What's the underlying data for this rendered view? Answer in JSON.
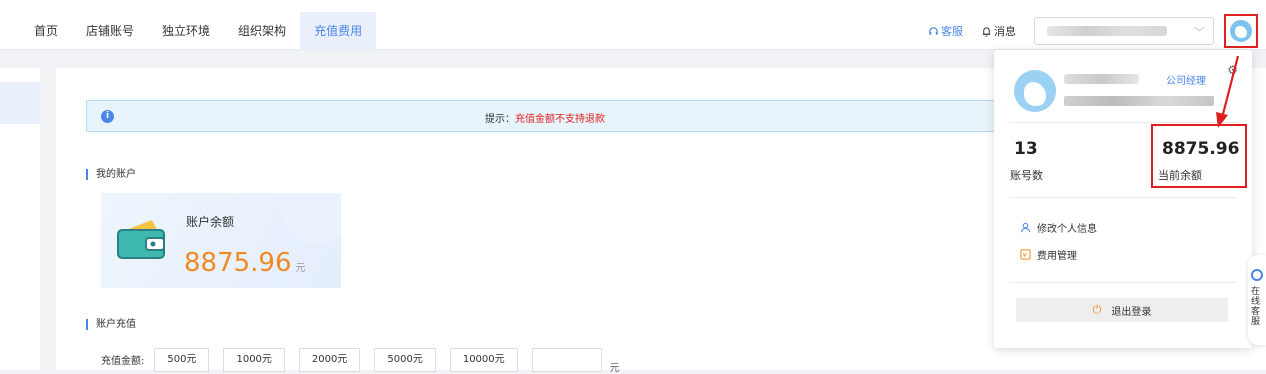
{
  "nav": {
    "items": [
      {
        "label": "首页",
        "active": false
      },
      {
        "label": "店铺账号",
        "active": false
      },
      {
        "label": "独立环境",
        "active": false
      },
      {
        "label": "组织架构",
        "active": false
      },
      {
        "label": "充值费用",
        "active": true
      }
    ]
  },
  "header": {
    "kefu_label": "客服",
    "message_label": "消息"
  },
  "alert": {
    "prefix": "提示：",
    "text": "充值金额不支持退款"
  },
  "account": {
    "section_title": "我的账户",
    "balance_label": "账户余额",
    "balance_amount": "8875.96",
    "balance_unit": "元"
  },
  "recharge": {
    "section_title": "账户充值",
    "label": "充值金额:",
    "options": [
      "500元",
      "1000元",
      "2000元",
      "5000元",
      "10000元"
    ],
    "unit": "元"
  },
  "popup": {
    "role": "公司经理",
    "account_count": "13",
    "account_count_label": "账号数",
    "current_balance": "8875.96",
    "current_balance_label": "当前余额",
    "menu": [
      {
        "label": "修改个人信息",
        "icon": "user-icon"
      },
      {
        "label": "费用管理",
        "icon": "fee-icon"
      }
    ],
    "logout_label": "退出登录"
  },
  "side_tab": {
    "label": "在线客服"
  },
  "colors": {
    "accent": "#4a86e8",
    "highlight": "#e02020",
    "amount": "#f08a24"
  }
}
